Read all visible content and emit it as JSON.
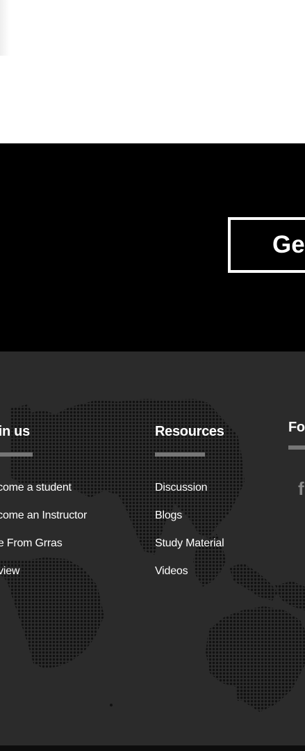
{
  "cta": {
    "button_label": "Get Started"
  },
  "footer": {
    "join": {
      "title": "Join us",
      "links": [
        "Become a student",
        "Become an Instructor",
        "Hire From Grras",
        "Review"
      ]
    },
    "resources": {
      "title": "Resources",
      "links": [
        "Discussion",
        "Blogs",
        "Study Material",
        "Videos"
      ]
    },
    "follow": {
      "title": "Follow us",
      "icons": [
        "facebook-icon"
      ]
    }
  },
  "colors": {
    "cta_background": "#000000",
    "footer_background": "#2b2b2b",
    "divider": "#767676",
    "text": "#ffffff",
    "social_icon": "#8a8a8a",
    "map_dots": "#111111"
  }
}
